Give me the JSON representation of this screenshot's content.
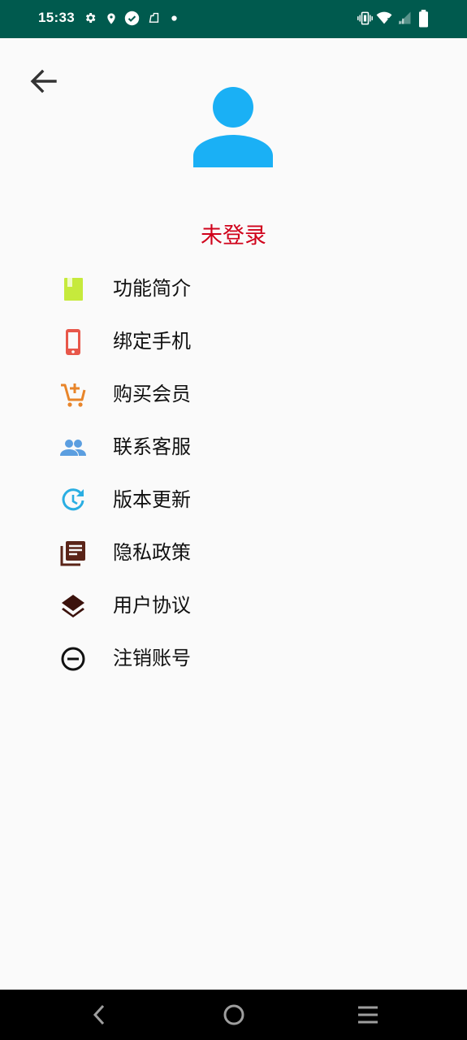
{
  "status_bar": {
    "time": "15:33",
    "left_icons": [
      "settings-icon",
      "location-icon",
      "check-circle-icon",
      "app-notification-icon",
      "dot-icon"
    ],
    "right_icons": [
      "vibrate-icon",
      "wifi-icon",
      "signal-icon",
      "battery-icon"
    ]
  },
  "header": {
    "back_icon": "arrow-left-icon",
    "avatar_icon": "person-icon",
    "avatar_color": "#1ab0f5"
  },
  "user": {
    "login_status": "未登录",
    "login_status_color": "#d0021b"
  },
  "menu": {
    "items": [
      {
        "label": "功能简介",
        "icon": "book-icon",
        "color": "#c6ea3c"
      },
      {
        "label": "绑定手机",
        "icon": "phone-icon",
        "color": "#e8574a"
      },
      {
        "label": "购买会员",
        "icon": "add-cart-icon",
        "color": "#e8852a"
      },
      {
        "label": "联系客服",
        "icon": "people-icon",
        "color": "#5b9ee0"
      },
      {
        "label": "版本更新",
        "icon": "update-icon",
        "color": "#2aaee2"
      },
      {
        "label": "隐私政策",
        "icon": "library-books-icon",
        "color": "#5a2418"
      },
      {
        "label": "用户协议",
        "icon": "layers-icon",
        "color": "#3b120c"
      },
      {
        "label": "注销账号",
        "icon": "minus-circle-icon",
        "color": "#111111"
      }
    ]
  },
  "nav_bar": {
    "buttons": [
      "back-icon",
      "home-icon",
      "recents-menu-icon"
    ]
  }
}
